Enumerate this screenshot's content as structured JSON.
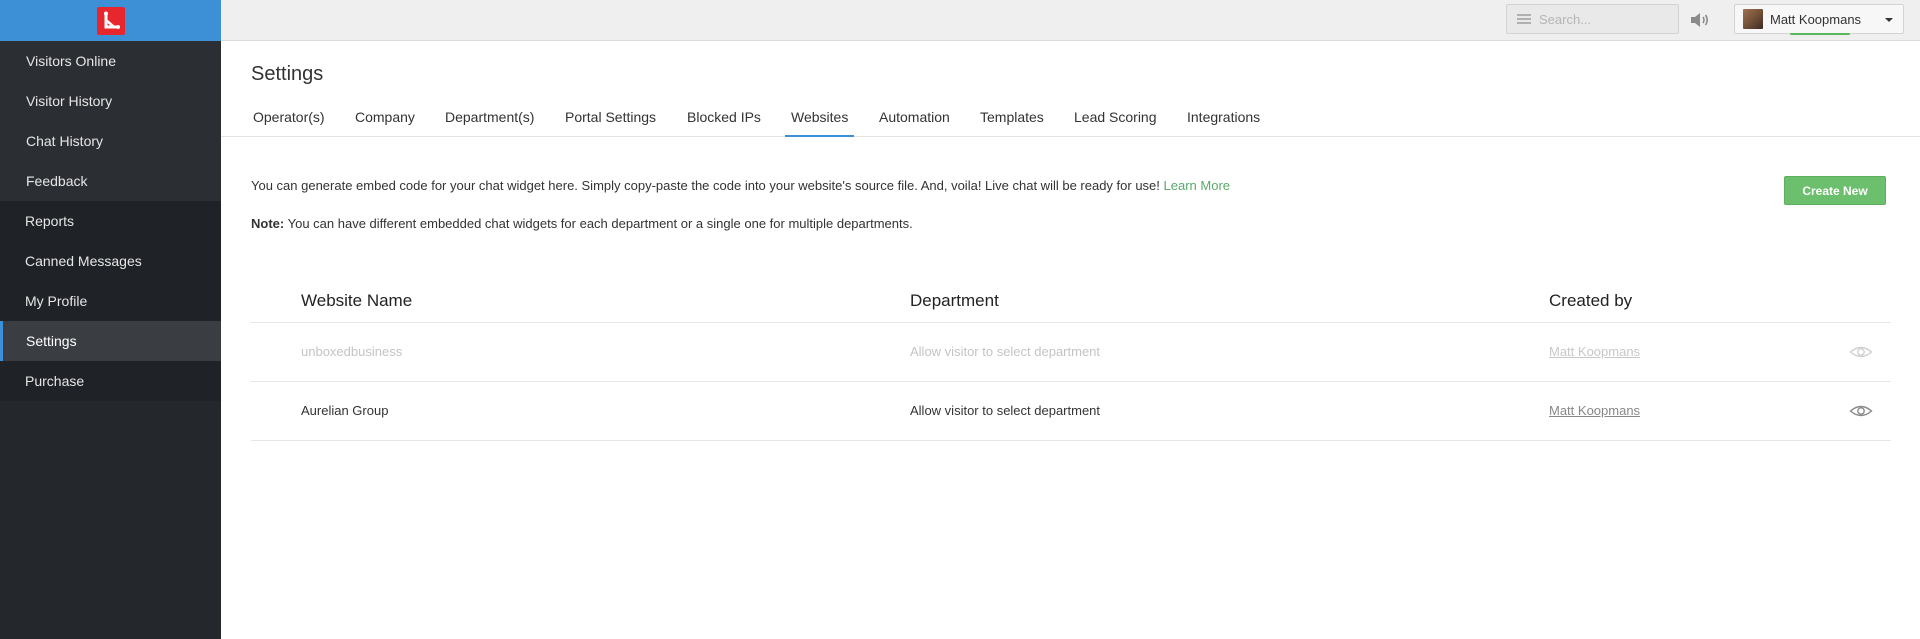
{
  "sidebar": {
    "items": [
      {
        "label": "Visitors Online"
      },
      {
        "label": "Visitor History"
      },
      {
        "label": "Chat History"
      },
      {
        "label": "Feedback"
      },
      {
        "label": "Reports"
      },
      {
        "label": "Canned Messages"
      },
      {
        "label": "My Profile"
      },
      {
        "label": "Settings"
      },
      {
        "label": "Purchase"
      }
    ],
    "active_label": "Settings"
  },
  "topbar": {
    "search_placeholder": "Search...",
    "user_name": "Matt Koopmans"
  },
  "page": {
    "title": "Settings",
    "tabs": [
      {
        "label": "Operator(s)"
      },
      {
        "label": "Company"
      },
      {
        "label": "Department(s)"
      },
      {
        "label": "Portal Settings"
      },
      {
        "label": "Blocked IPs"
      },
      {
        "label": "Websites"
      },
      {
        "label": "Automation"
      },
      {
        "label": "Templates"
      },
      {
        "label": "Lead Scoring"
      },
      {
        "label": "Integrations"
      }
    ],
    "active_tab": "Websites",
    "intro_text": "You can generate embed code for your chat widget here. Simply copy-paste the code into your website's source file. And, voila! Live chat will be ready for use!",
    "learn_more": "Learn More",
    "note_label": "Note:",
    "note_text": "You can have different embedded chat widgets for each department or a single one for multiple departments.",
    "create_button": "Create New"
  },
  "table": {
    "headers": {
      "website_name": "Website Name",
      "department": "Department",
      "created_by": "Created by"
    },
    "rows": [
      {
        "website_name": "unboxedbusiness",
        "department": "Allow visitor to select department",
        "created_by": "Matt Koopmans",
        "status": "inactive"
      },
      {
        "website_name": "Aurelian Group",
        "department": "Allow visitor to select department",
        "created_by": "Matt Koopmans",
        "status": "active"
      }
    ]
  },
  "colors": {
    "accent": "#3d8fd6",
    "sidebar_bg": "#24272c",
    "logo_red": "#e8262d",
    "create_button_green": "#6cbf6c",
    "learn_more_green": "#5aa86a"
  },
  "icons": [
    "app-logo-icon",
    "menu-lines-icon",
    "volume-icon",
    "avatar",
    "caret-down-icon",
    "eye-icon"
  ]
}
